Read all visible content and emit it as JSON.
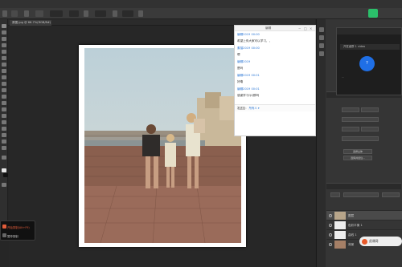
{
  "document": {
    "tab_label": "原图.jpg @ 66.7%(RGB/8#)"
  },
  "chat": {
    "title": "编辑",
    "controls": [
      "−",
      "□",
      "×"
    ],
    "messages": [
      {
        "text": "编辑2019 00:00",
        "style": "blue"
      },
      {
        "text": "希望上传大家可以学习，，",
        "style": "dark"
      },
      {
        "text": "素描2019 00:00",
        "style": "blue"
      },
      {
        "text": "嗯",
        "style": "dark"
      },
      {
        "text": "编辑2019",
        "style": "blue"
      },
      {
        "text": "是吗",
        "style": "dark"
      },
      {
        "text": "编辑2019 00:01",
        "style": "blue"
      },
      {
        "text": "好嘞",
        "style": "dark"
      },
      {
        "text": "编辑2019 00:01",
        "style": "blue"
      },
      {
        "text": "感谢学习QQ群吗",
        "style": "dark"
      }
    ],
    "input_label": "发送至：",
    "input_target": "所有人 ▾"
  },
  "mini_window": {
    "row_label": "开发者群 1 video",
    "circle_text": "?",
    "caption": "..."
  },
  "panels": {
    "button_1": "选择主体",
    "button_2": "选择并遮住...",
    "layers": [
      {
        "name": "图层"
      },
      {
        "name": "色彩平衡 1"
      },
      {
        "name": "曲线 1"
      },
      {
        "name": "背景"
      }
    ]
  },
  "toast": {
    "line1": "开始录制(Alt+F9)",
    "line2": "暂停录制"
  },
  "watermark": {
    "text": "虎课网"
  }
}
